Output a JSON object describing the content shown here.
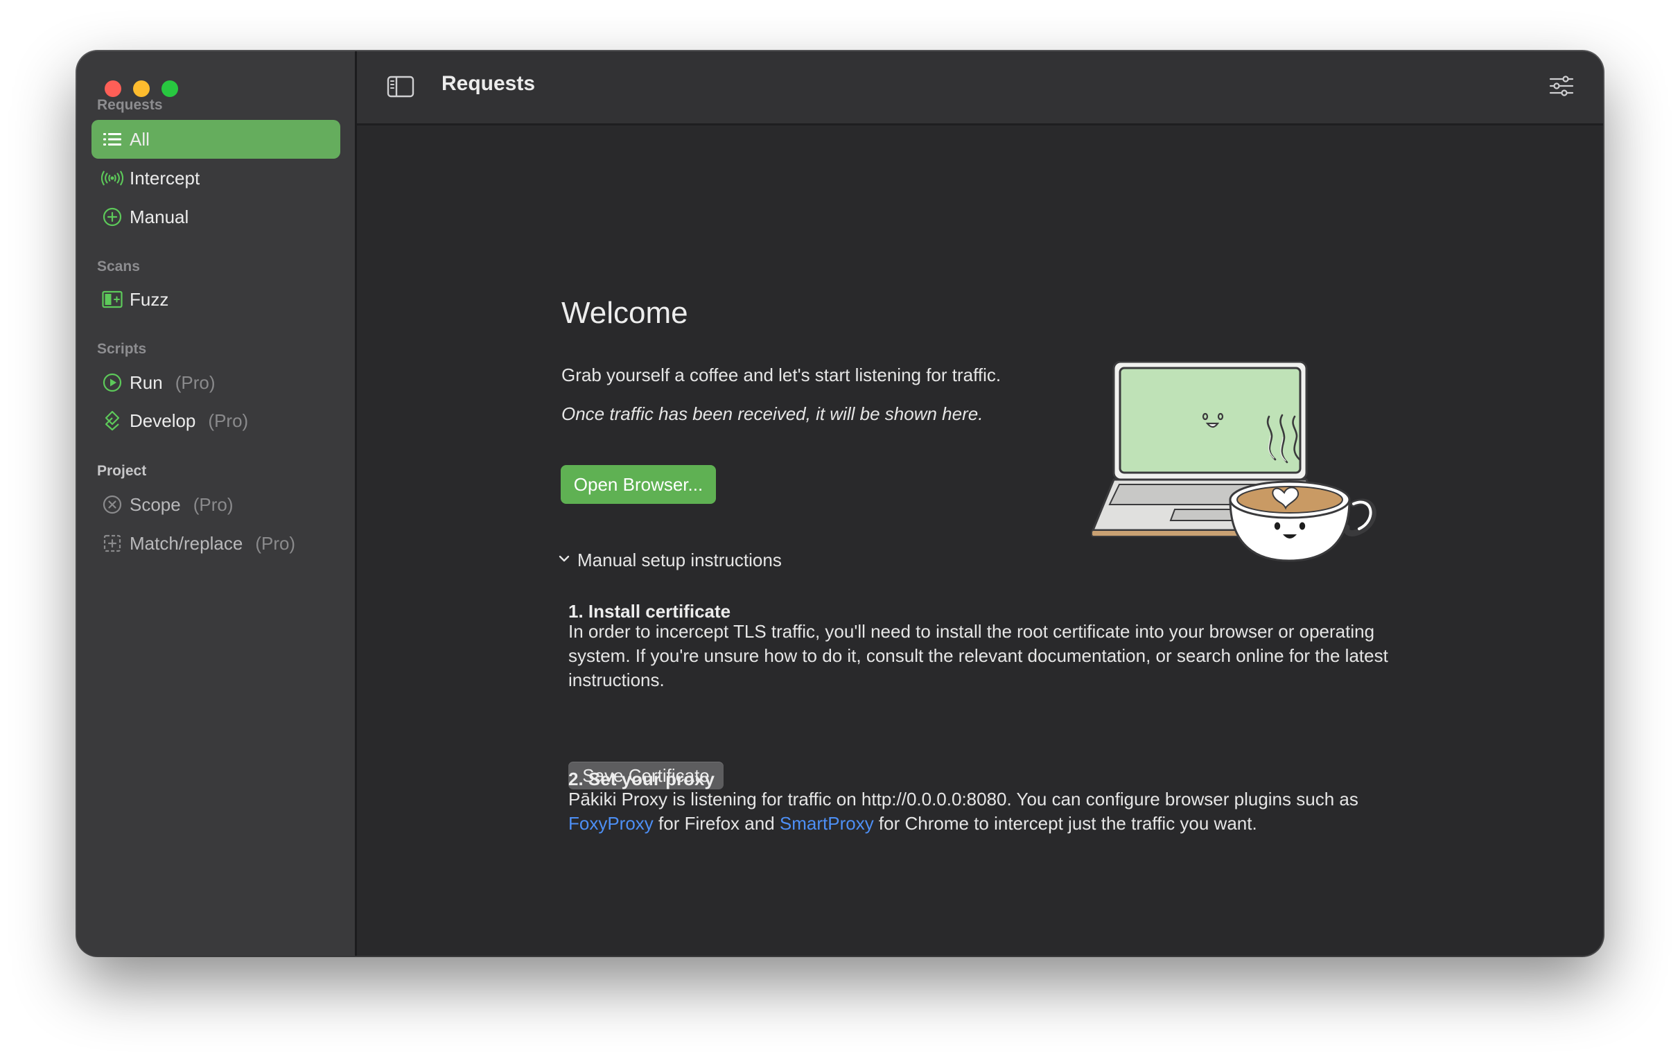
{
  "window": {
    "title": "Requests"
  },
  "sidebar": {
    "sections": {
      "requests": "Requests",
      "scans": "Scans",
      "scripts": "Scripts",
      "project": "Project"
    },
    "items": {
      "all": "All",
      "intercept": "Intercept",
      "manual": "Manual",
      "fuzz": "Fuzz",
      "run": "Run",
      "develop": "Develop",
      "scope": "Scope",
      "match_replace": "Match/replace"
    },
    "pro_badge": "(Pro)"
  },
  "main": {
    "welcome_title": "Welcome",
    "intro": "Grab yourself a coffee and let's start listening for traffic.",
    "hint": "Once traffic has been received, it will be shown here.",
    "open_browser_button": "Open Browser...",
    "manual_setup_toggle": "Manual setup instructions",
    "step1": {
      "title": "1. Install certificate",
      "text": "In order to incercept TLS traffic, you'll need to install the root certificate into your browser or operating system. If you're unsure how to do it, consult the relevant documentation, or search online for the latest instructions.",
      "button": "Save Certificate"
    },
    "step2": {
      "title": "2. Set your proxy",
      "text_part1": "Pākiki Proxy is listening for traffic on http://0.0.0.0:8080. You can configure browser plugins such as ",
      "link1": "FoxyProxy",
      "text_part2": " for Firefox and ",
      "link2": "SmartProxy",
      "text_part3": " for Chrome to intercept just the traffic you want."
    }
  },
  "icons": {
    "all": "list-icon",
    "intercept": "broadcast-icon",
    "manual": "plus-circle-icon",
    "fuzz": "fuzz-icon",
    "run": "play-circle-icon",
    "develop": "develop-icon",
    "scope": "x-circle-icon",
    "match_replace": "match-replace-icon",
    "sidebar_toggle": "sidebar-toggle-icon",
    "filter": "filter-sliders-icon"
  },
  "colors": {
    "accent": "#65ad5d",
    "button_green": "#5fb153",
    "link": "#4d8ff5",
    "icon_green": "#5dc95a"
  }
}
